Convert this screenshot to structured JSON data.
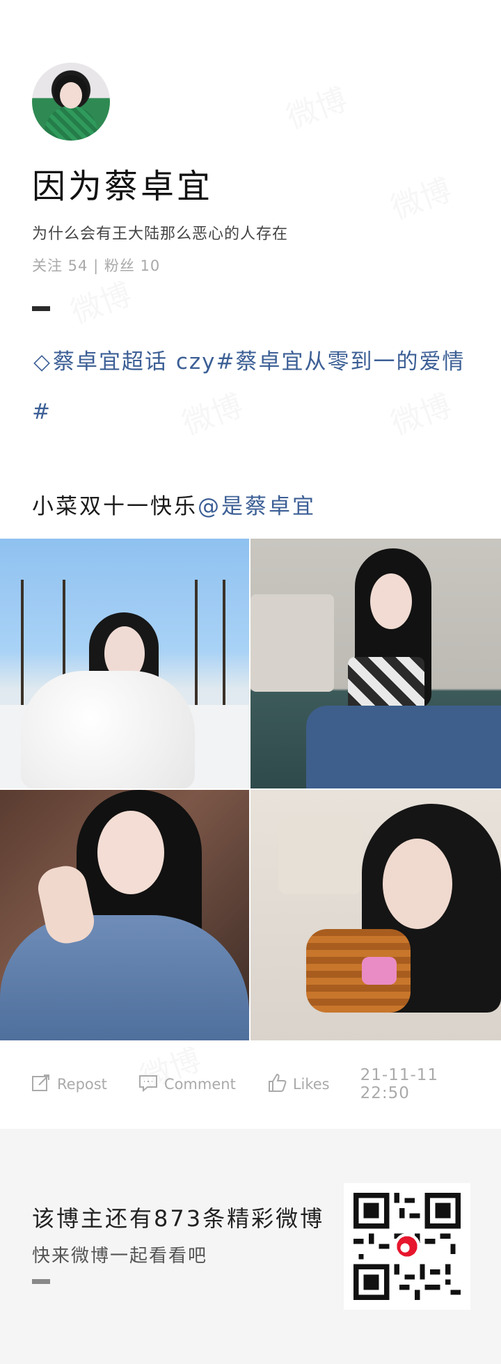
{
  "profile": {
    "username": "因为蔡卓宜",
    "bio": "为什么会有王大陆那么恶心的人存在",
    "stats": "关注 54 | 粉丝 10"
  },
  "topic": {
    "diamond": "◇",
    "text": "蔡卓宜超话 czy#蔡卓宜从零到一的爱情#"
  },
  "post": {
    "text": "小菜双十一快乐",
    "mention": "@是蔡卓宜"
  },
  "actions": {
    "repost": "Repost",
    "comment": "Comment",
    "likes": "Likes",
    "timestamp": "21-11-11 22:50"
  },
  "footer": {
    "title": "该博主还有873条精彩微博",
    "subtitle": "快来微博一起看看吧"
  },
  "watermark": {
    "text": "微博"
  },
  "colors": {
    "link": "#3c5f95",
    "muted": "#aaaaaa",
    "footer_bg": "#f5f5f5",
    "weibo_red": "#e6162d"
  }
}
